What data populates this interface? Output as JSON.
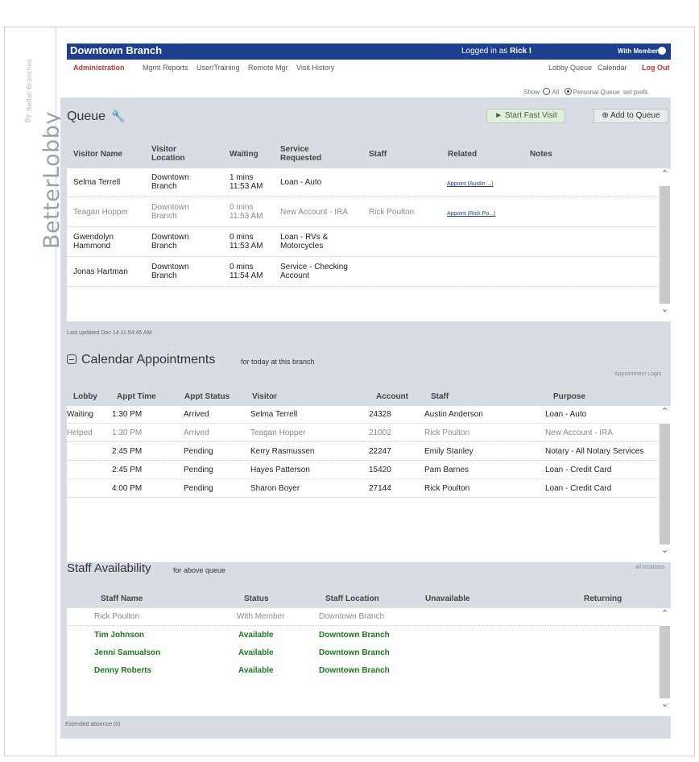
{
  "brand": {
    "name": "BetterLobby",
    "by": "By",
    "maker": "Better Branches"
  },
  "header": {
    "branch": "Downtown Branch",
    "logged_in_prefix": "Logged in as",
    "user": "Rick I",
    "status": "With Member"
  },
  "nav": {
    "items": [
      "Administration",
      "Mgmt Reports",
      "User/Training",
      "Remote Mgr",
      "Visit History"
    ],
    "right": [
      "Lobby Queue",
      "Calendar",
      "Log Out"
    ]
  },
  "prefs": {
    "show": "Show",
    "all": "All",
    "personal": "Personal Queue",
    "set_prefs": "set prefs"
  },
  "queue": {
    "title": "Queue",
    "fast_visit": "► Start Fast Visit",
    "add": "Add to Queue",
    "headers": [
      "Visitor Name",
      "Visitor Location",
      "Waiting",
      "Service Requested",
      "Staff",
      "Related",
      "Notes"
    ],
    "rows": [
      {
        "name": "Selma Terrell",
        "location": "Downtown Branch",
        "wait": "1 mins",
        "time": "11:53 AM",
        "service": "Loan - Auto",
        "staff": "",
        "related": "Appoint (Austin ...)",
        "dim": false
      },
      {
        "name": "Teagan Hopper",
        "location": "Downtown Branch",
        "wait": "0 mins",
        "time": "11:53 AM",
        "service": "New Account - IRA",
        "staff": "Rick Poulton",
        "related": "Appoint (Rick Po...)",
        "dim": true
      },
      {
        "name": "Gwendolyn Hammond",
        "location": "Downtown Branch",
        "wait": "0 mins",
        "time": "11:53 AM",
        "service": "Loan - RVs & Motorcycles",
        "staff": "",
        "related": "",
        "dim": false
      },
      {
        "name": "Jonas Hartman",
        "location": "Downtown Branch",
        "wait": "0 mins",
        "time": "11:54 AM",
        "service": "Service - Checking Account",
        "staff": "",
        "related": "",
        "dim": false
      }
    ],
    "last_updated": "Last updated Dec 14 11:54:46 AM"
  },
  "calendar": {
    "title": "Calendar Appointments",
    "subtitle": "for today at this branch",
    "login": "Appointment Login",
    "headers": [
      "Lobby",
      "Appt Time",
      "Appt Status",
      "Visitor",
      "Account",
      "Staff",
      "Purpose"
    ],
    "rows": [
      {
        "lobby": "Waiting",
        "time": "1:30 PM",
        "status": "Arrived",
        "visitor": "Selma Terrell",
        "account": "24328",
        "staff": "Austin Anderson",
        "purpose": "Loan - Auto",
        "dim": false
      },
      {
        "lobby": "Helped",
        "time": "1:30 PM",
        "status": "Arrived",
        "visitor": "Teagan Hopper",
        "account": "21002",
        "staff": "Rick Poulton",
        "purpose": "New Account - IRA",
        "dim": true
      },
      {
        "lobby": "",
        "time": "2:45 PM",
        "status": "Pending",
        "visitor": "Kerry Rasmussen",
        "account": "22247",
        "staff": "Emily Stanley",
        "purpose": "Notary - All Notary Services",
        "dim": false
      },
      {
        "lobby": "",
        "time": "2:45 PM",
        "status": "Pending",
        "visitor": "Hayes Patterson",
        "account": "15420",
        "staff": "Pam Barnes",
        "purpose": "Loan - Credit Card",
        "dim": false
      },
      {
        "lobby": "",
        "time": "4:00 PM",
        "status": "Pending",
        "visitor": "Sharon Boyer",
        "account": "27144",
        "staff": "Rick Poulton",
        "purpose": "Loan - Credit Card",
        "dim": false
      }
    ]
  },
  "staff": {
    "title": "Staff Availability",
    "subtitle": "for above queue",
    "all_locations": "all locations",
    "headers": [
      "Staff Name",
      "Status",
      "Staff Location",
      "Unavailable",
      "Returning"
    ],
    "rows": [
      {
        "name": "Rick Poulton",
        "status": "With Member",
        "location": "Downtown Branch",
        "dim": true
      },
      {
        "name": "Tim Johnson",
        "status": "Available",
        "location": "Downtown Branch",
        "dim": false
      },
      {
        "name": "Jenni Samualson",
        "status": "Available",
        "location": "Downtown Branch",
        "dim": false
      },
      {
        "name": "Denny Roberts",
        "status": "Available",
        "location": "Downtown Branch",
        "dim": false
      }
    ],
    "extended": "Extended absence (0)"
  }
}
